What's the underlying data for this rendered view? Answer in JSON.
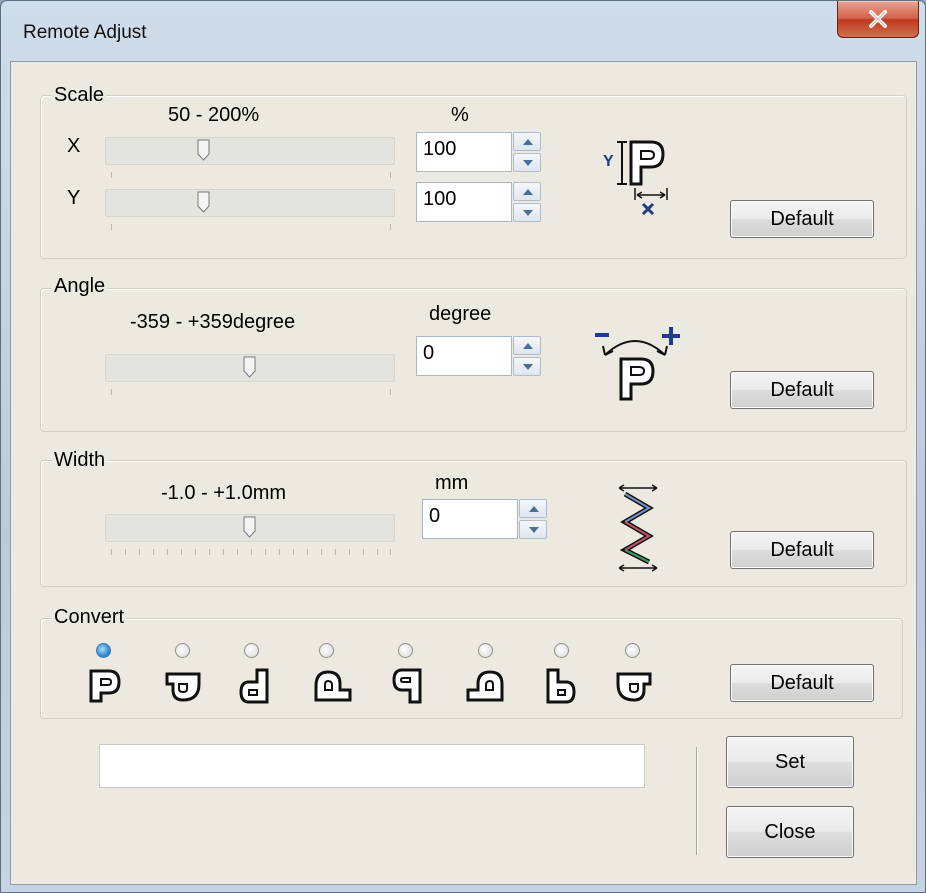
{
  "window": {
    "title": "Remote Adjust"
  },
  "scale": {
    "label": "Scale",
    "range_label": "50 - 200%",
    "unit_label": "%",
    "x_label": "X",
    "y_label": "Y",
    "x_value": "100",
    "y_value": "100",
    "x_slider_fraction": 0.33,
    "y_slider_fraction": 0.33,
    "default_label": "Default",
    "icon": "scale-xy-icon"
  },
  "angle": {
    "label": "Angle",
    "range_label": "-359 - +359degree",
    "unit_label": "degree",
    "value": "0",
    "slider_fraction": 0.5,
    "default_label": "Default",
    "icon": "rotate-icon"
  },
  "width": {
    "label": "Width",
    "range_label": "-1.0 - +1.0mm",
    "unit_label": "mm",
    "value": "0",
    "slider_fraction": 0.5,
    "default_label": "Default",
    "icon": "zigzag-width-icon"
  },
  "convert": {
    "label": "Convert",
    "selected_index": 0,
    "options": [
      "p-normal",
      "p-rotated-90",
      "d-mirror",
      "p-rotated-180",
      "q-mirror",
      "p-rotated-270",
      "b-mirror",
      "p-flip"
    ],
    "default_label": "Default"
  },
  "footer": {
    "status_text": "",
    "set_label": "Set",
    "close_label": "Close"
  },
  "colors": {
    "accent": "#3d8fd3",
    "icon_outline": "#1a1a1a",
    "icon_blue": "#1f3c88"
  }
}
